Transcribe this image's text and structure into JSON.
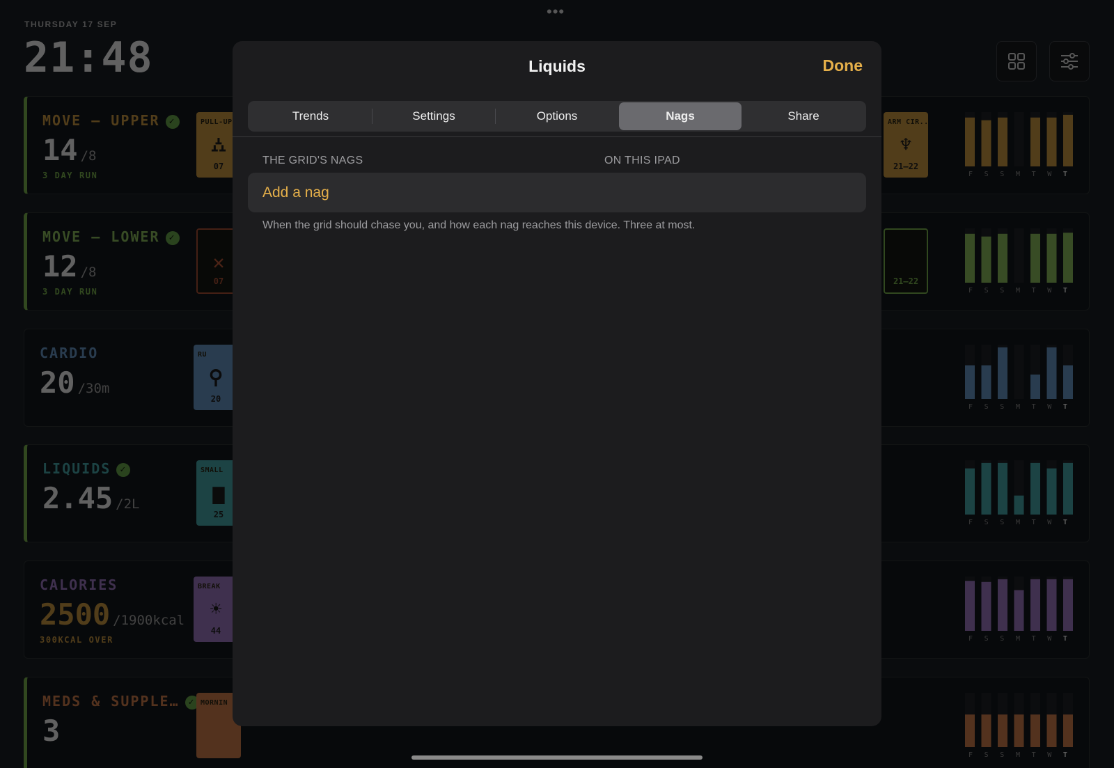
{
  "background": {
    "date": "THURSDAY 17 SEP",
    "time": "21:48",
    "day_letters": [
      "F",
      "S",
      "S",
      "M",
      "T",
      "W",
      "T"
    ],
    "rows": [
      {
        "title": "MOVE — UPPER",
        "done": true,
        "value": "14",
        "goal": "/8",
        "sub": "3 DAY RUN",
        "color": "#c9902e",
        "tiles": [
          {
            "label": "PULL-UP",
            "value": "07",
            "icon": "pullup-icon"
          },
          {
            "label": "ARM CIR...",
            "value": "21–22",
            "icon": "figure-icon"
          }
        ]
      },
      {
        "title": "MOVE — LOWER",
        "done": true,
        "value": "12",
        "goal": "/8",
        "sub": "3 DAY RUN",
        "color": "#7fb84a",
        "tiles": [
          {
            "label": "",
            "value": "07",
            "icon": "cross-icon"
          },
          {
            "label": "",
            "value": "21–22",
            "icon": ""
          }
        ]
      },
      {
        "title": "CARDIO",
        "done": false,
        "value": "20",
        "goal": "/30m",
        "sub": "",
        "color": "#5b8fc4",
        "tiles": [
          {
            "label": "RU",
            "value": "20",
            "icon": "runner-icon"
          }
        ]
      },
      {
        "title": "LIQUIDS",
        "done": true,
        "value": "2.45",
        "goal": "/2L",
        "sub": "",
        "color": "#36a3a7",
        "tiles": [
          {
            "label": "SMALL",
            "value": "25",
            "icon": "cup-icon"
          }
        ]
      },
      {
        "title": "CALORIES",
        "done": false,
        "value": "2500",
        "goal": "/1900kcal",
        "sub": "300KCAL OVER",
        "color": "#9a6fc4",
        "tiles": [
          {
            "label": "BREAK",
            "value": "44",
            "icon": "sun-icon"
          }
        ]
      },
      {
        "title": "MEDS & SUPPLE…",
        "done": true,
        "value": "3",
        "goal": "",
        "sub": "",
        "color": "#d2743d",
        "tiles": [
          {
            "label": "MORNIN",
            "value": "",
            "icon": ""
          }
        ]
      }
    ]
  },
  "modal": {
    "title": "Liquids",
    "done_label": "Done",
    "tabs": [
      {
        "label": "Trends",
        "active": false
      },
      {
        "label": "Settings",
        "active": false
      },
      {
        "label": "Options",
        "active": false
      },
      {
        "label": "Nags",
        "active": true
      },
      {
        "label": "Share",
        "active": false
      }
    ],
    "section_left": "THE GRID'S NAGS",
    "section_right": "ON THIS IPAD",
    "add_label": "Add a nag",
    "footnote": "When the grid should chase you, and how each nag reaches this device. Three at most."
  }
}
